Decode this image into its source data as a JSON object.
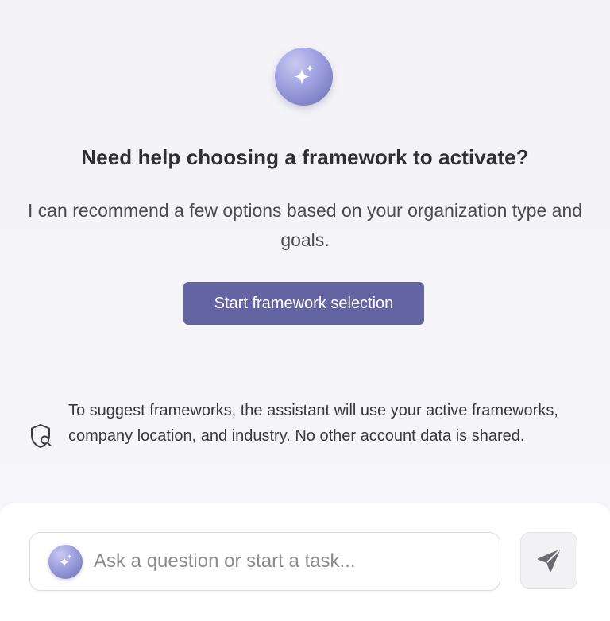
{
  "hero": {
    "icon": "sparkle-icon",
    "title": "Need help choosing a framework to activate?",
    "description": "I can recommend a few options based on your organization type and goals.",
    "button_label": "Start framework selection"
  },
  "privacy_notice": {
    "icon": "shield-search-icon",
    "text": "To suggest frameworks, the assistant will use your active frameworks, company location, and industry. No other account data is shared."
  },
  "composer": {
    "assistant_icon": "sparkle-icon",
    "placeholder": "Ask a question or start a task...",
    "value": "",
    "send_icon": "send-icon"
  },
  "colors": {
    "accent": "#6364a1",
    "badge_gradient_light": "#c8c9f0",
    "badge_gradient_dark": "#6a6cb8",
    "background": "#f5f5f8"
  }
}
